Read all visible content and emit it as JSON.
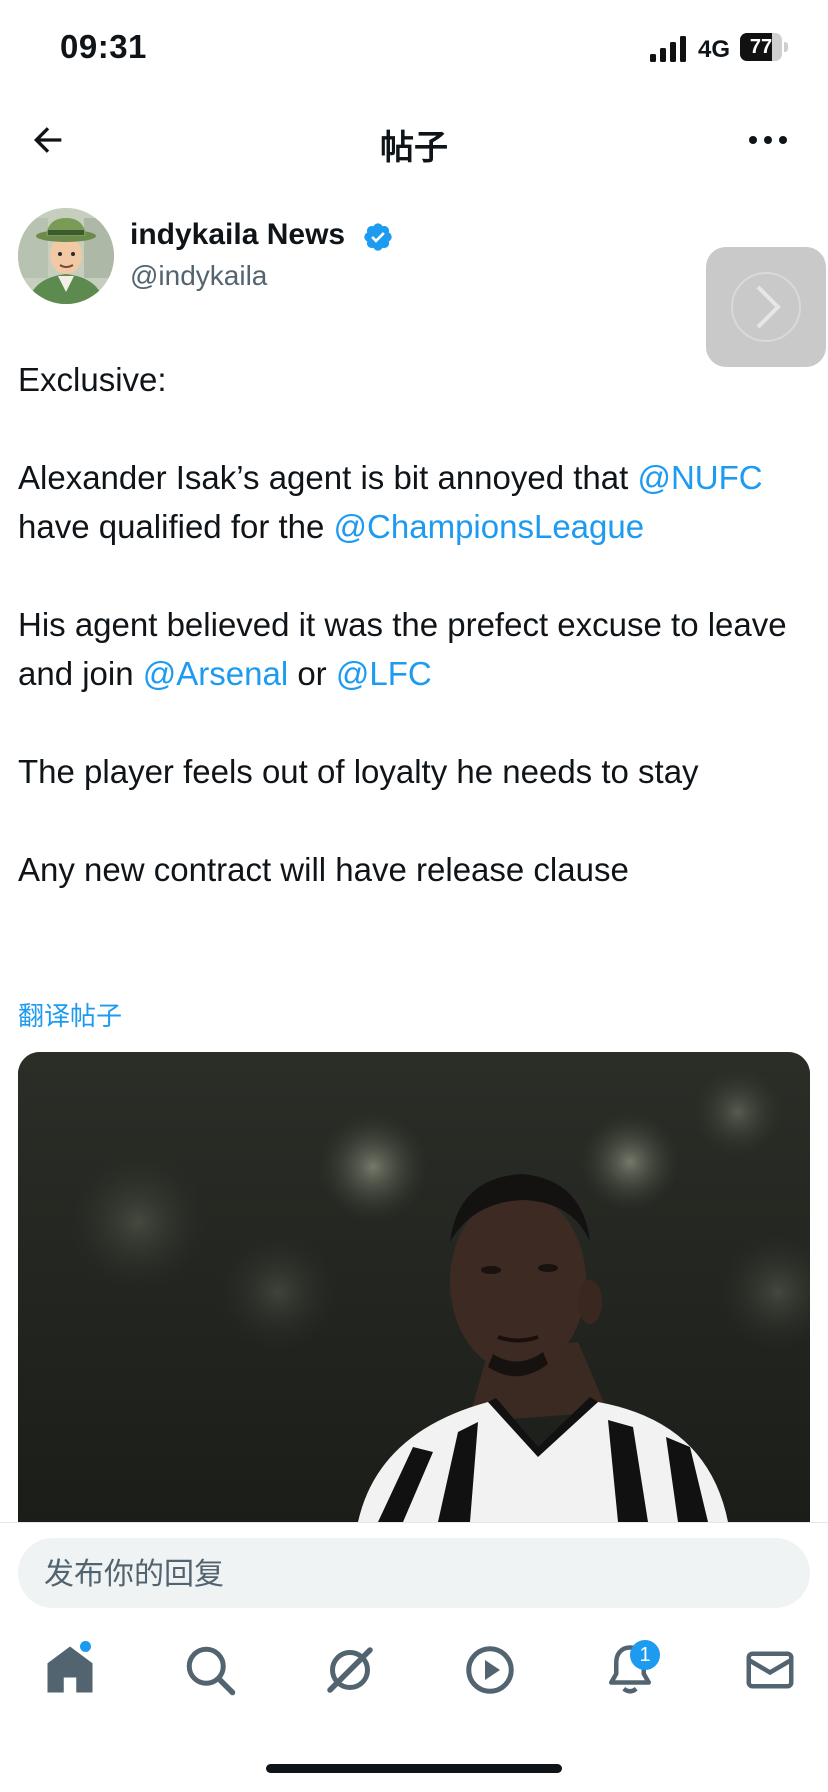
{
  "status_bar": {
    "time": "09:31",
    "network": "4G",
    "battery_level": "77",
    "battery_fraction": 0.77
  },
  "header": {
    "title": "帖子",
    "back_icon": "arrow-left-icon",
    "more_icon": "more-horizontal-icon"
  },
  "author": {
    "name": "indykaila News",
    "handle": "@indykaila",
    "verified": true
  },
  "tweet": {
    "line1": "Exclusive:",
    "p2_text1": "Alexander Isak’s agent is bit annoyed that ",
    "p2_mention1": "@NUFC",
    "p2_text2": " have qualified for the ",
    "p2_mention2": "@ChampionsLeague",
    "p3_text1": "His agent believed it was the prefect excuse to leave and join ",
    "p3_mention1": "@Arsenal",
    "p3_text2": " or ",
    "p3_mention2": "@LFC",
    "p4": "The player feels out of loyalty he needs to stay",
    "p5": "Any new contract will have release clause"
  },
  "translate_label": "翻译帖子",
  "reply": {
    "placeholder": "发布你的回复"
  },
  "tab_bar": {
    "items": [
      "home-icon",
      "search-icon",
      "grok-icon",
      "video-icon",
      "notifications-icon",
      "messages-icon"
    ],
    "notification_count": "1"
  },
  "colors": {
    "accent": "#1d9bf0",
    "text": "#0f1419",
    "muted": "#536471"
  }
}
